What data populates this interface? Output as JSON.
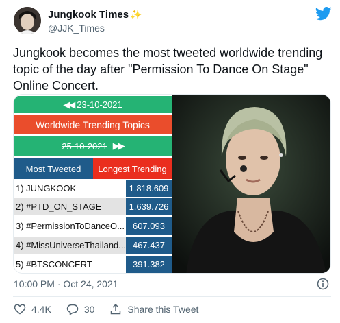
{
  "author": {
    "name": "Jungkook Times",
    "sparkle": "✨",
    "handle": "@JJK_Times"
  },
  "tweet": {
    "text": "Jungkook becomes the most tweeted worldwide trending topic of the day after \"Permission To Dance On Stage\" Online Concert.",
    "timestamp": "10:00 PM · Oct 24, 2021"
  },
  "media": {
    "date_current": "23-10-2021",
    "date_prev_arrow": "◀◀",
    "title": "Worldwide Trending Topics",
    "date_next": "25-10-2021",
    "date_next_arrow": "▶▶",
    "tab_most": "Most Tweeted",
    "tab_longest": "Longest Trending",
    "rows": [
      {
        "rank": "1) JUNGKOOK",
        "value": "1.818.609"
      },
      {
        "rank": "2) #PTD_ON_STAGE",
        "value": "1.639.726"
      },
      {
        "rank": "3) #PermissionToDanceO...",
        "value": "607.093"
      },
      {
        "rank": "4) #MissUniverseThailand...",
        "value": "467.437"
      },
      {
        "rank": "5) #BTSCONCERT",
        "value": "391.382"
      }
    ]
  },
  "actions": {
    "likes": "4.4K",
    "replies": "30",
    "share": "Share this Tweet"
  },
  "colors": {
    "twitter_blue": "#1d9bf0",
    "green": "#25b374",
    "red": "#ea4d2c",
    "navy": "#1f5b8a"
  }
}
